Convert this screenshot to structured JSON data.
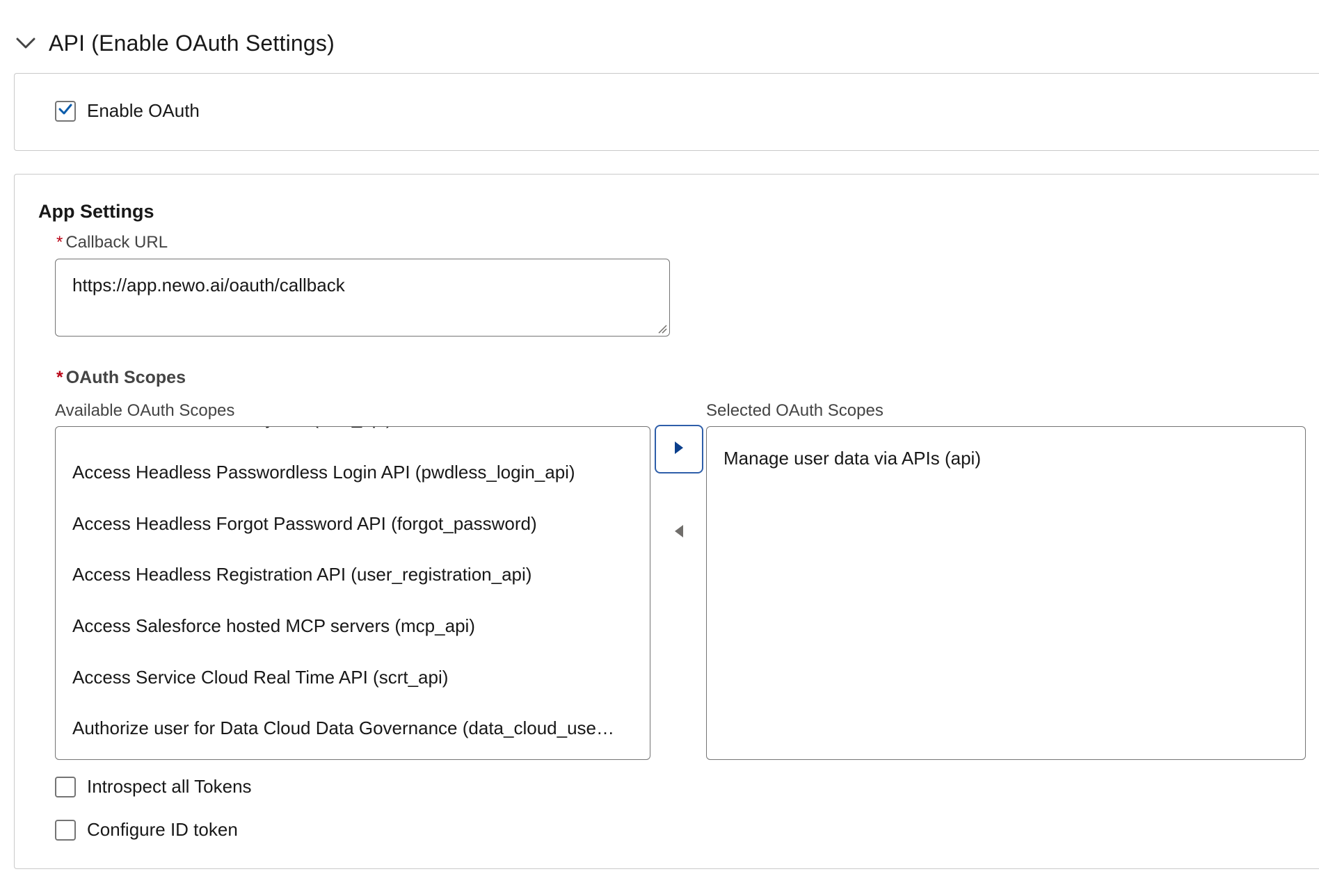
{
  "section": {
    "title": "API (Enable OAuth Settings)",
    "chevron_icon": "chevron-down-icon"
  },
  "enable_oauth": {
    "label": "Enable OAuth",
    "checked": true
  },
  "app_settings": {
    "title": "App Settings",
    "callback_url": {
      "required_marker": "*",
      "label": "Callback URL",
      "value": "https://app.newo.ai/oauth/callback"
    },
    "oauth_scopes": {
      "required_marker": "*",
      "label": "OAuth Scopes",
      "available_label": "Available OAuth Scopes",
      "selected_label": "Selected OAuth Scopes",
      "available_items": [
        "Access Headless Passwordless Login API (pwdless_login_api)",
        "Access Headless Forgot Password API (forgot_password)",
        "Access Headless Registration API (user_registration_api)",
        "Access Salesforce hosted MCP servers (mcp_api)",
        "Access Service Cloud Real Time API (scrt_api)",
        "Authorize user for Data Cloud Data Governance (data_cloud_use…"
      ],
      "selected_items": [
        "Manage user data via APIs (api)"
      ],
      "move_right_icon": "triangle-right-icon",
      "move_left_icon": "triangle-left-icon"
    },
    "introspect_tokens": {
      "label": "Introspect all Tokens",
      "checked": false
    },
    "configure_id_token": {
      "label": "Configure ID token",
      "checked": false
    }
  },
  "colors": {
    "checkbox_check": "#0b5cab",
    "required": "#ba0517",
    "button_border": "#2e5ea9",
    "move_right_arrow": "#0b3f8c",
    "move_left_arrow": "#706e6b"
  }
}
